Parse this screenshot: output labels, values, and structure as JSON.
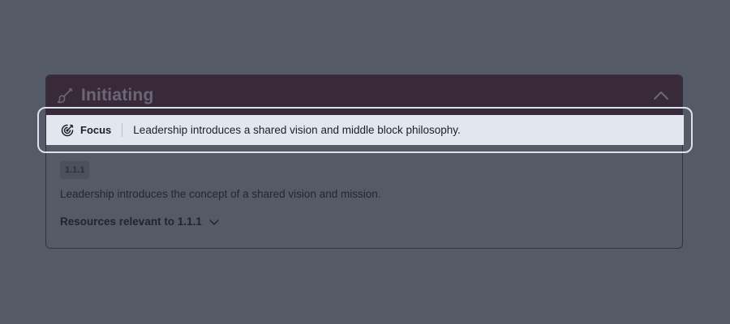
{
  "stage": {
    "title": "Initiating",
    "icon": "brush-icon",
    "collapse_icon": "chevron-up-icon"
  },
  "focus": {
    "icon": "target-arrow-icon",
    "label": "Focus",
    "text": "Leadership introduces a shared vision and middle block philosophy."
  },
  "item": {
    "code": "1.1.1",
    "description": "Leadership introduces the concept of a shared vision and mission.",
    "resources_label": "Resources relevant to 1.1.1",
    "resources_icon": "chevron-down-icon"
  },
  "colors": {
    "overlay": "#545b67",
    "header_bg": "#382a39",
    "focus_bg": "#e2e7ef",
    "focus_outline": "#dde2ea"
  }
}
